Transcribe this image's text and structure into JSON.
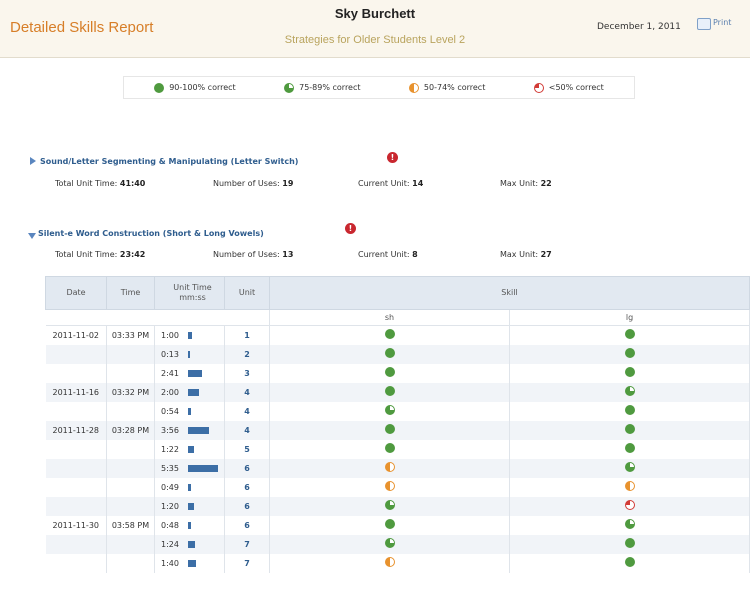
{
  "header": {
    "report_title": "Detailed Skills Report",
    "student_name": "Sky Burchett",
    "program": "Strategies for Older Students Level 2",
    "date": "December 1, 2011",
    "print_label": "Print"
  },
  "legend": [
    {
      "icon": "full-green",
      "label": "90-100% correct"
    },
    {
      "icon": "three-quarter-green",
      "label": "75-89% correct"
    },
    {
      "icon": "half-orange",
      "label": "50-74% correct"
    },
    {
      "icon": "quarter-red",
      "label": "<50% correct"
    }
  ],
  "sections": [
    {
      "title": "Sound/Letter Segmenting & Manipulating (Letter Switch)",
      "expanded": false,
      "total_time_label": "Total Unit Time:",
      "total_time": "41:40",
      "uses_label": "Number of Uses:",
      "uses": "19",
      "current_label": "Current Unit:",
      "current": "14",
      "max_label": "Max Unit:",
      "max": "22"
    },
    {
      "title": "Silent-e Word Construction (Short & Long Vowels)",
      "expanded": true,
      "total_time_label": "Total Unit Time:",
      "total_time": "23:42",
      "uses_label": "Number of Uses:",
      "uses": "13",
      "current_label": "Current Unit:",
      "current": "8",
      "max_label": "Max Unit:",
      "max": "27"
    }
  ],
  "table": {
    "headers": {
      "date": "Date",
      "time": "Time",
      "unit_time": "Unit Time\nmm:ss",
      "unit": "Unit",
      "skill": "Skill"
    },
    "skill_cols": {
      "sh": "sh",
      "lg": "lg"
    },
    "rows": [
      {
        "date": "2011-11-02",
        "time": "03:33 PM",
        "unit_time": "1:00",
        "bar_fraction": 0.12,
        "unit": "1",
        "sh": "full-green",
        "lg": "full-green"
      },
      {
        "date": "",
        "time": "",
        "unit_time": "0:13",
        "bar_fraction": 0.03,
        "unit": "2",
        "sh": "full-green",
        "lg": "full-green"
      },
      {
        "date": "",
        "time": "",
        "unit_time": "2:41",
        "bar_fraction": 0.45,
        "unit": "3",
        "sh": "full-green",
        "lg": "full-green"
      },
      {
        "date": "2011-11-16",
        "time": "03:32 PM",
        "unit_time": "2:00",
        "bar_fraction": 0.35,
        "unit": "4",
        "sh": "full-green",
        "lg": "three-quarter-green"
      },
      {
        "date": "",
        "time": "",
        "unit_time": "0:54",
        "bar_fraction": 0.1,
        "unit": "4",
        "sh": "three-quarter-green",
        "lg": "full-green"
      },
      {
        "date": "2011-11-28",
        "time": "03:28 PM",
        "unit_time": "3:56",
        "bar_fraction": 0.7,
        "unit": "4",
        "sh": "full-green",
        "lg": "full-green"
      },
      {
        "date": "",
        "time": "",
        "unit_time": "1:22",
        "bar_fraction": 0.2,
        "unit": "5",
        "sh": "full-green",
        "lg": "full-green"
      },
      {
        "date": "",
        "time": "",
        "unit_time": "5:35",
        "bar_fraction": 1.0,
        "unit": "6",
        "sh": "half-orange",
        "lg": "three-quarter-green"
      },
      {
        "date": "",
        "time": "",
        "unit_time": "0:49",
        "bar_fraction": 0.1,
        "unit": "6",
        "sh": "half-orange",
        "lg": "half-orange"
      },
      {
        "date": "",
        "time": "",
        "unit_time": "1:20",
        "bar_fraction": 0.2,
        "unit": "6",
        "sh": "three-quarter-green",
        "lg": "quarter-red"
      },
      {
        "date": "2011-11-30",
        "time": "03:58 PM",
        "unit_time": "0:48",
        "bar_fraction": 0.1,
        "unit": "6",
        "sh": "full-green",
        "lg": "three-quarter-green"
      },
      {
        "date": "",
        "time": "",
        "unit_time": "1:24",
        "bar_fraction": 0.22,
        "unit": "7",
        "sh": "three-quarter-green",
        "lg": "full-green"
      },
      {
        "date": "",
        "time": "",
        "unit_time": "1:40",
        "bar_fraction": 0.25,
        "unit": "7",
        "sh": "half-orange",
        "lg": "full-green"
      }
    ]
  }
}
